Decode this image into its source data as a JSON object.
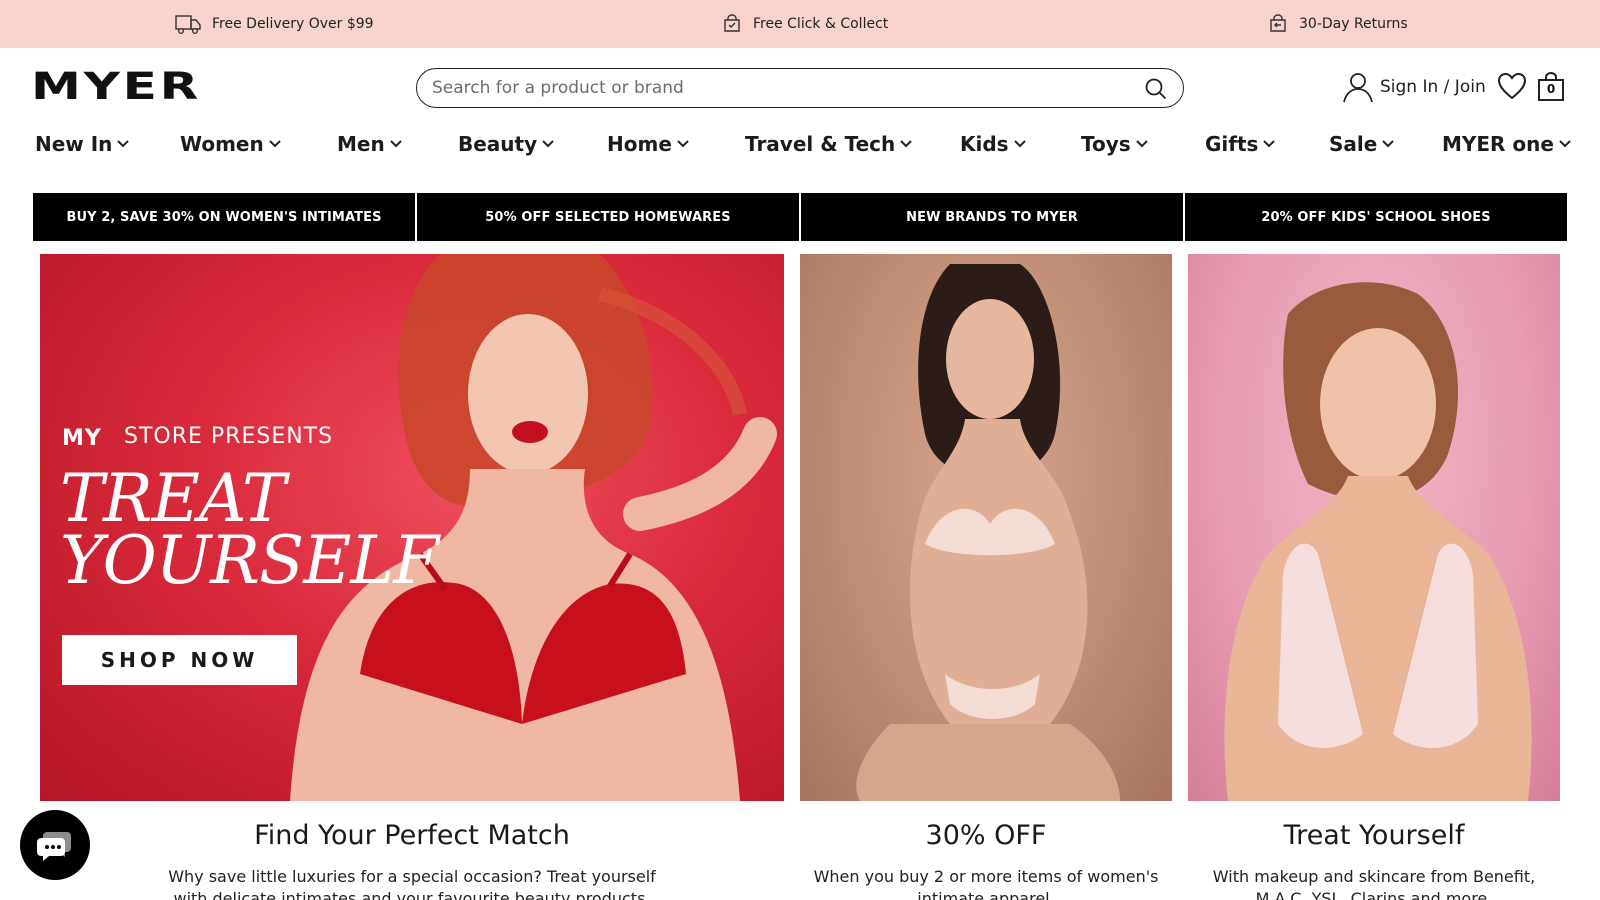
{
  "service_bar": {
    "items": [
      {
        "label": "Free Delivery Over $99",
        "icon": "truck-icon"
      },
      {
        "label": "Free Click & Collect",
        "icon": "click-collect-icon"
      },
      {
        "label": "30-Day Returns",
        "icon": "returns-icon"
      }
    ],
    "background": "#f9d3cd"
  },
  "header": {
    "logo": "MYER",
    "search": {
      "placeholder": "Search for a product or brand",
      "value": ""
    },
    "account_label": "Sign In / Join",
    "bag_count": "0"
  },
  "nav": {
    "categories": [
      "New In",
      "Women",
      "Men",
      "Beauty",
      "Home",
      "Travel & Tech",
      "Kids",
      "Toys",
      "Gifts",
      "Sale",
      "MYER one"
    ]
  },
  "promos": [
    "BUY 2, SAVE 30% ON WOMEN'S INTIMATES",
    "50% OFF SELECTED HOMEWARES",
    "NEW BRANDS TO MYER",
    "20% OFF KIDS' SCHOOL SHOES"
  ],
  "hero": {
    "brand_tag": "STORE PRESENTS",
    "brand_logo": "MY",
    "headline": "TREAT YOURSELF",
    "cta": "SHOP NOW"
  },
  "tiles": [
    {
      "title": "Find Your Perfect Match",
      "description": "Why save little luxuries for a special occasion? Treat yourself with delicate intimates and your favourite beauty products."
    },
    {
      "title": "30% OFF",
      "description": "When you buy 2 or more items of women's intimate apparel."
    },
    {
      "title": "Treat Yourself",
      "description": "With makeup and skincare from Benefit, M.A.C, YSL, Clarins and more."
    }
  ],
  "colors": {
    "accent_red": "#d92a3a",
    "promo_bg": "#000000",
    "text": "#1a1a1a"
  },
  "chat": {
    "icon": "chat-icon"
  }
}
